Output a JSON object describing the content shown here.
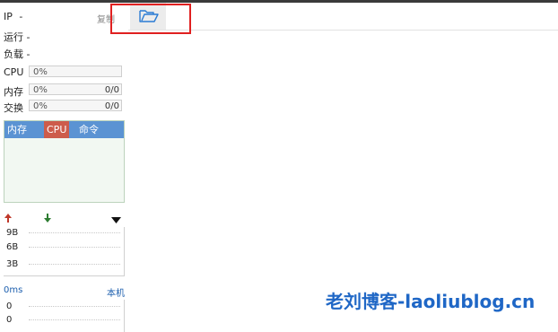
{
  "server": {
    "ip_label": "IP",
    "ip_value": "-",
    "uptime_label": "运行",
    "uptime_value": "-",
    "load_label": "负载",
    "load_value": "-",
    "copy_label": "复制"
  },
  "meters": [
    {
      "label": "CPU",
      "percent_text": "0%",
      "amount": "",
      "fill_fraction": 0
    },
    {
      "label": "内存",
      "percent_text": "0%",
      "amount": "0/0",
      "fill_fraction": 0
    },
    {
      "label": "交换",
      "percent_text": "0%",
      "amount": "0/0",
      "fill_fraction": 0
    }
  ],
  "process_tabs": [
    {
      "label": "内存",
      "active": false
    },
    {
      "label": "CPU",
      "active": true
    },
    {
      "label": "命令",
      "active": false
    }
  ],
  "network": {
    "upload_icon": "arrow-up-icon",
    "download_icon": "arrow-down-icon",
    "menu_icon": "caret-down-icon",
    "traffic_labels": [
      "9B",
      "6B",
      "3B"
    ],
    "colors": {
      "upload": "#c0392b",
      "download": "#2e7d32"
    }
  },
  "latency": {
    "value": "0ms",
    "target": "本机",
    "rows": [
      "0",
      "0"
    ]
  },
  "tabs": {
    "folder_icon": "folder-open-icon"
  },
  "watermark": "老刘博客-laoliublog.cn",
  "colors": {
    "accent": "#5b93d3",
    "active_tab": "#cd5c4b",
    "highlight": "#e02020"
  }
}
